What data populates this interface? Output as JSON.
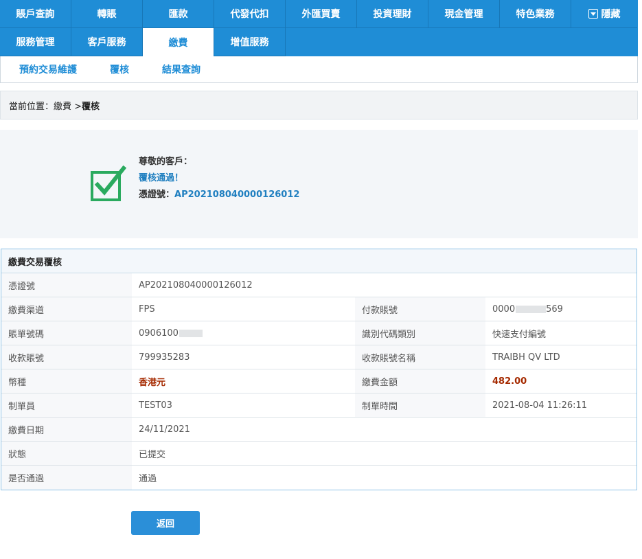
{
  "nav": {
    "row1": [
      "賬戶查詢",
      "轉賬",
      "匯款",
      "代發代扣",
      "外匯買賣",
      "投資理財",
      "現金管理",
      "特色業務"
    ],
    "hide_label": "隱藏",
    "row2": [
      "服務管理",
      "客戶服務",
      "繳費",
      "增值服務"
    ],
    "active": "繳費"
  },
  "subnav": [
    "預約交易維護",
    "覆核",
    "結果查詢"
  ],
  "breadcrumb": {
    "prefix": "當前位置：繳費 > ",
    "current": "覆核"
  },
  "result": {
    "greeting": "尊敬的客戶：",
    "message": "覆核通過！",
    "voucher_label": "憑證號：",
    "voucher_no": "AP202108040000126012",
    "status_icon": "check-icon"
  },
  "detail": {
    "title": "繳費交易覆核",
    "voucher_label": "憑證號",
    "voucher_value": "AP202108040000126012",
    "rows": [
      {
        "l1": "繳費渠道",
        "v1": "FPS",
        "l2": "付款賬號",
        "v2_prefix": "0000",
        "v2_suffix": "569"
      },
      {
        "l1": "賬單號碼",
        "v1_prefix": "0906100",
        "l2": "識別代碼類別",
        "v2": "快速支付編號"
      },
      {
        "l1": "收款賬號",
        "v1": "799935283",
        "l2": "收款賬號名稱",
        "v2": "TRAIBH QV LTD"
      },
      {
        "l1": "幣種",
        "v1": "香港元",
        "l2": "繳費金額",
        "v2": "482.00"
      },
      {
        "l1": "制單員",
        "v1": "TEST03",
        "l2": "制單時間",
        "v2": "2021-08-04 11:26:11"
      }
    ],
    "date_label": "繳費日期",
    "date_value": "24/11/2021",
    "status_label": "狀態",
    "status_value": "已提交",
    "approved_label": "是否通過",
    "approved_value": "通過"
  },
  "back_button": "返回",
  "colors": {
    "accent": "#1f8dd6",
    "success": "#2aaa5f",
    "amount": "#a52a00"
  }
}
